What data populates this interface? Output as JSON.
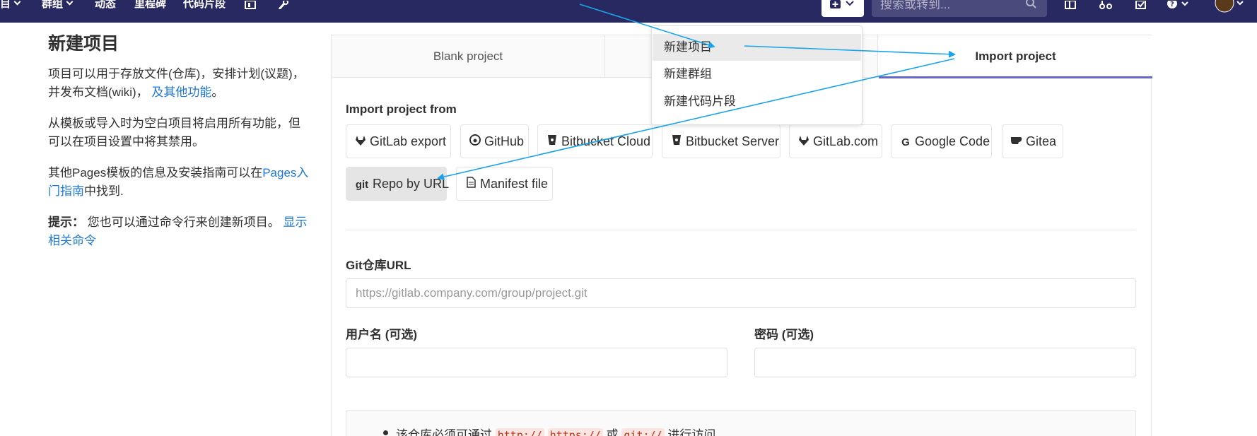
{
  "topnav": {
    "items": [
      {
        "label": "目",
        "has_caret": true
      },
      {
        "label": "群组",
        "has_caret": true
      },
      {
        "label": "动态",
        "has_caret": false
      },
      {
        "label": "里程碑",
        "has_caret": false
      },
      {
        "label": "代码片段",
        "has_caret": false
      }
    ],
    "search_placeholder": "搜索或转到...",
    "icons": [
      "chart-icon",
      "wrench-icon",
      "plus-square-icon",
      "search-icon",
      "sidebar-icon",
      "merge-request-icon",
      "todo-icon",
      "help-icon",
      "avatar"
    ],
    "bg_color": "#292961"
  },
  "left": {
    "title": "新建项目",
    "p1_text": "项目可以用于存放文件(仓库)，安排计划(议题)，并发布文档(wiki)，",
    "p1_link": "及其他功能",
    "p1_end": "。",
    "p2": "从模板或导入时为空白项目将启用所有功能，但可以在项目设置中将其禁用。",
    "p3_text": "其他Pages模板的信息及安装指南可以在",
    "p3_link": "Pages入门指南",
    "p3_end": "中找到.",
    "tip_label": "提示：",
    "tip_text": "您也可以通过命令行来创建新项目。",
    "tip_link": "显示相关命令"
  },
  "tabs": [
    {
      "label": "Blank project",
      "active": false
    },
    {
      "label": "",
      "active": false
    },
    {
      "label": "Import project",
      "active": true
    }
  ],
  "import": {
    "heading": "Import project from",
    "sources": [
      {
        "label": "GitLab export",
        "icon": "gitlab-icon"
      },
      {
        "label": "GitHub",
        "icon": "github-icon"
      },
      {
        "label": "Bitbucket Cloud",
        "icon": "bitbucket-icon"
      },
      {
        "label": "Bitbucket Server",
        "icon": "bitbucket-icon"
      },
      {
        "label": "GitLab.com",
        "icon": "gitlab-icon"
      },
      {
        "label": "Google Code",
        "icon": "google-icon"
      },
      {
        "label": "Gitea",
        "icon": "gitea-icon"
      },
      {
        "label": "Repo by URL",
        "icon": "git-icon",
        "icon_text": "git",
        "active": true
      },
      {
        "label": "Manifest file",
        "icon": "file-icon"
      }
    ]
  },
  "form": {
    "url_label": "Git仓库URL",
    "url_placeholder": "https://gitlab.company.com/group/project.git",
    "username_label": "用户名 (可选)",
    "password_label": "密码 (可选)",
    "note_text_pre": "该仓库必须可通过",
    "note_code1": "http://",
    "note_code2": "https://",
    "note_or": "或",
    "note_code3": "git://",
    "note_text_post": "进行访问"
  },
  "dropdown": {
    "items": [
      "新建项目",
      "新建群组",
      "新建代码片段"
    ],
    "highlighted_index": 0
  },
  "colors": {
    "accent": "#6666c4",
    "link": "#1f78d1",
    "annotation_arrow": "#1aa3e8"
  }
}
